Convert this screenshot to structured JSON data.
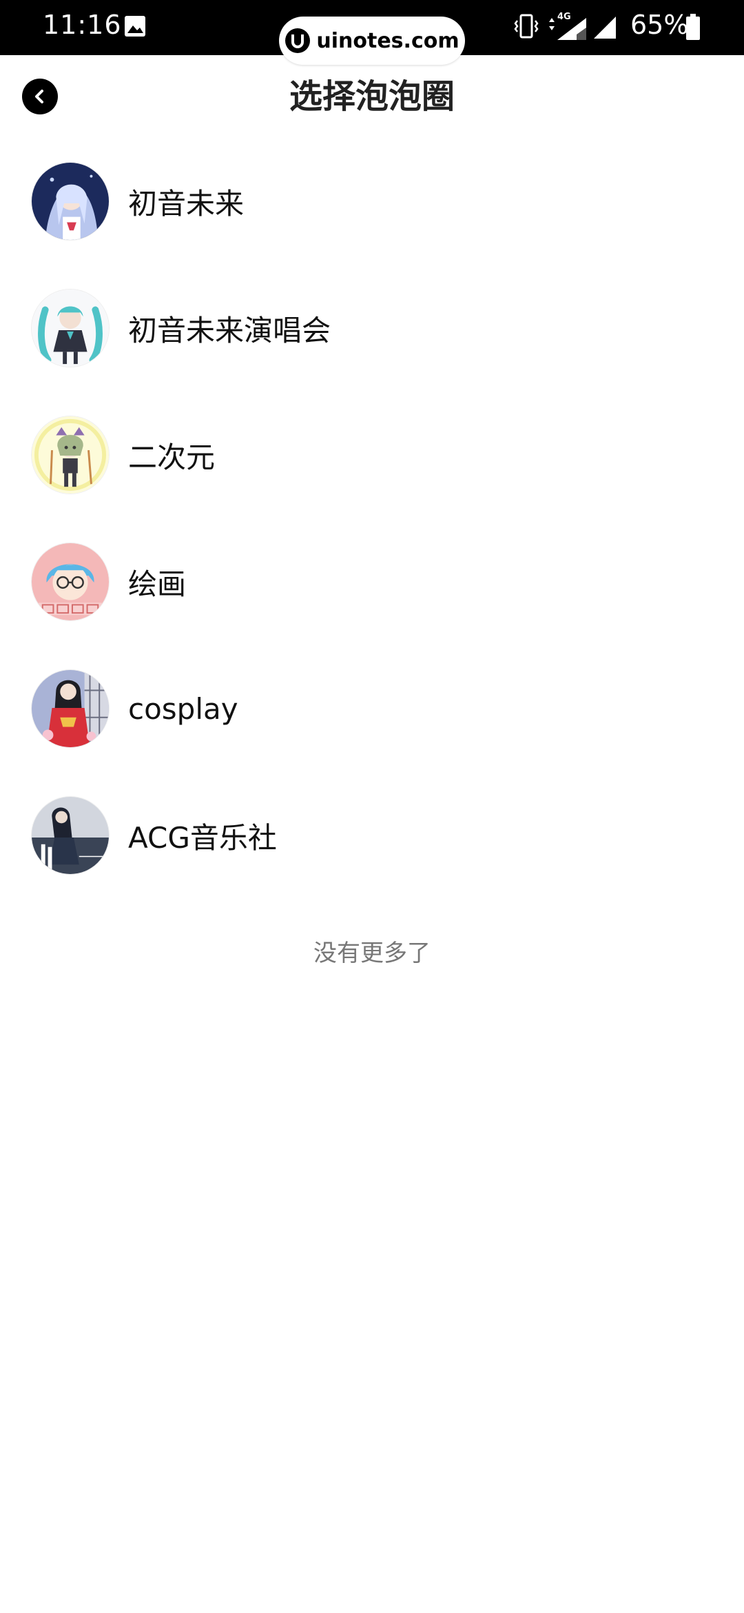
{
  "status_bar": {
    "time": "11:16",
    "battery": "65%",
    "network": "4G",
    "gallery_icon": "image-icon",
    "vibrate_icon": "vibrate-icon",
    "signal_icon": "signal-icon"
  },
  "watermark": {
    "text": "uinotes.com"
  },
  "nav": {
    "back_icon": "back-arrow-icon",
    "title": "选择泡泡圈"
  },
  "circles": [
    {
      "label": "初音未来",
      "avatar": "hatsune-miku-avatar"
    },
    {
      "label": "初音未来演唱会",
      "avatar": "miku-concert-avatar"
    },
    {
      "label": "二次元",
      "avatar": "anime-character-avatar"
    },
    {
      "label": "绘画",
      "avatar": "painting-avatar"
    },
    {
      "label": "cosplay",
      "avatar": "cosplay-avatar"
    },
    {
      "label": "ACG音乐社",
      "avatar": "acg-music-avatar"
    }
  ],
  "footer": {
    "end_text": "没有更多了"
  },
  "colors": {
    "status_bar_bg": "#000000",
    "background": "#ffffff",
    "title": "#222222",
    "label": "#111111",
    "muted": "#777777"
  }
}
